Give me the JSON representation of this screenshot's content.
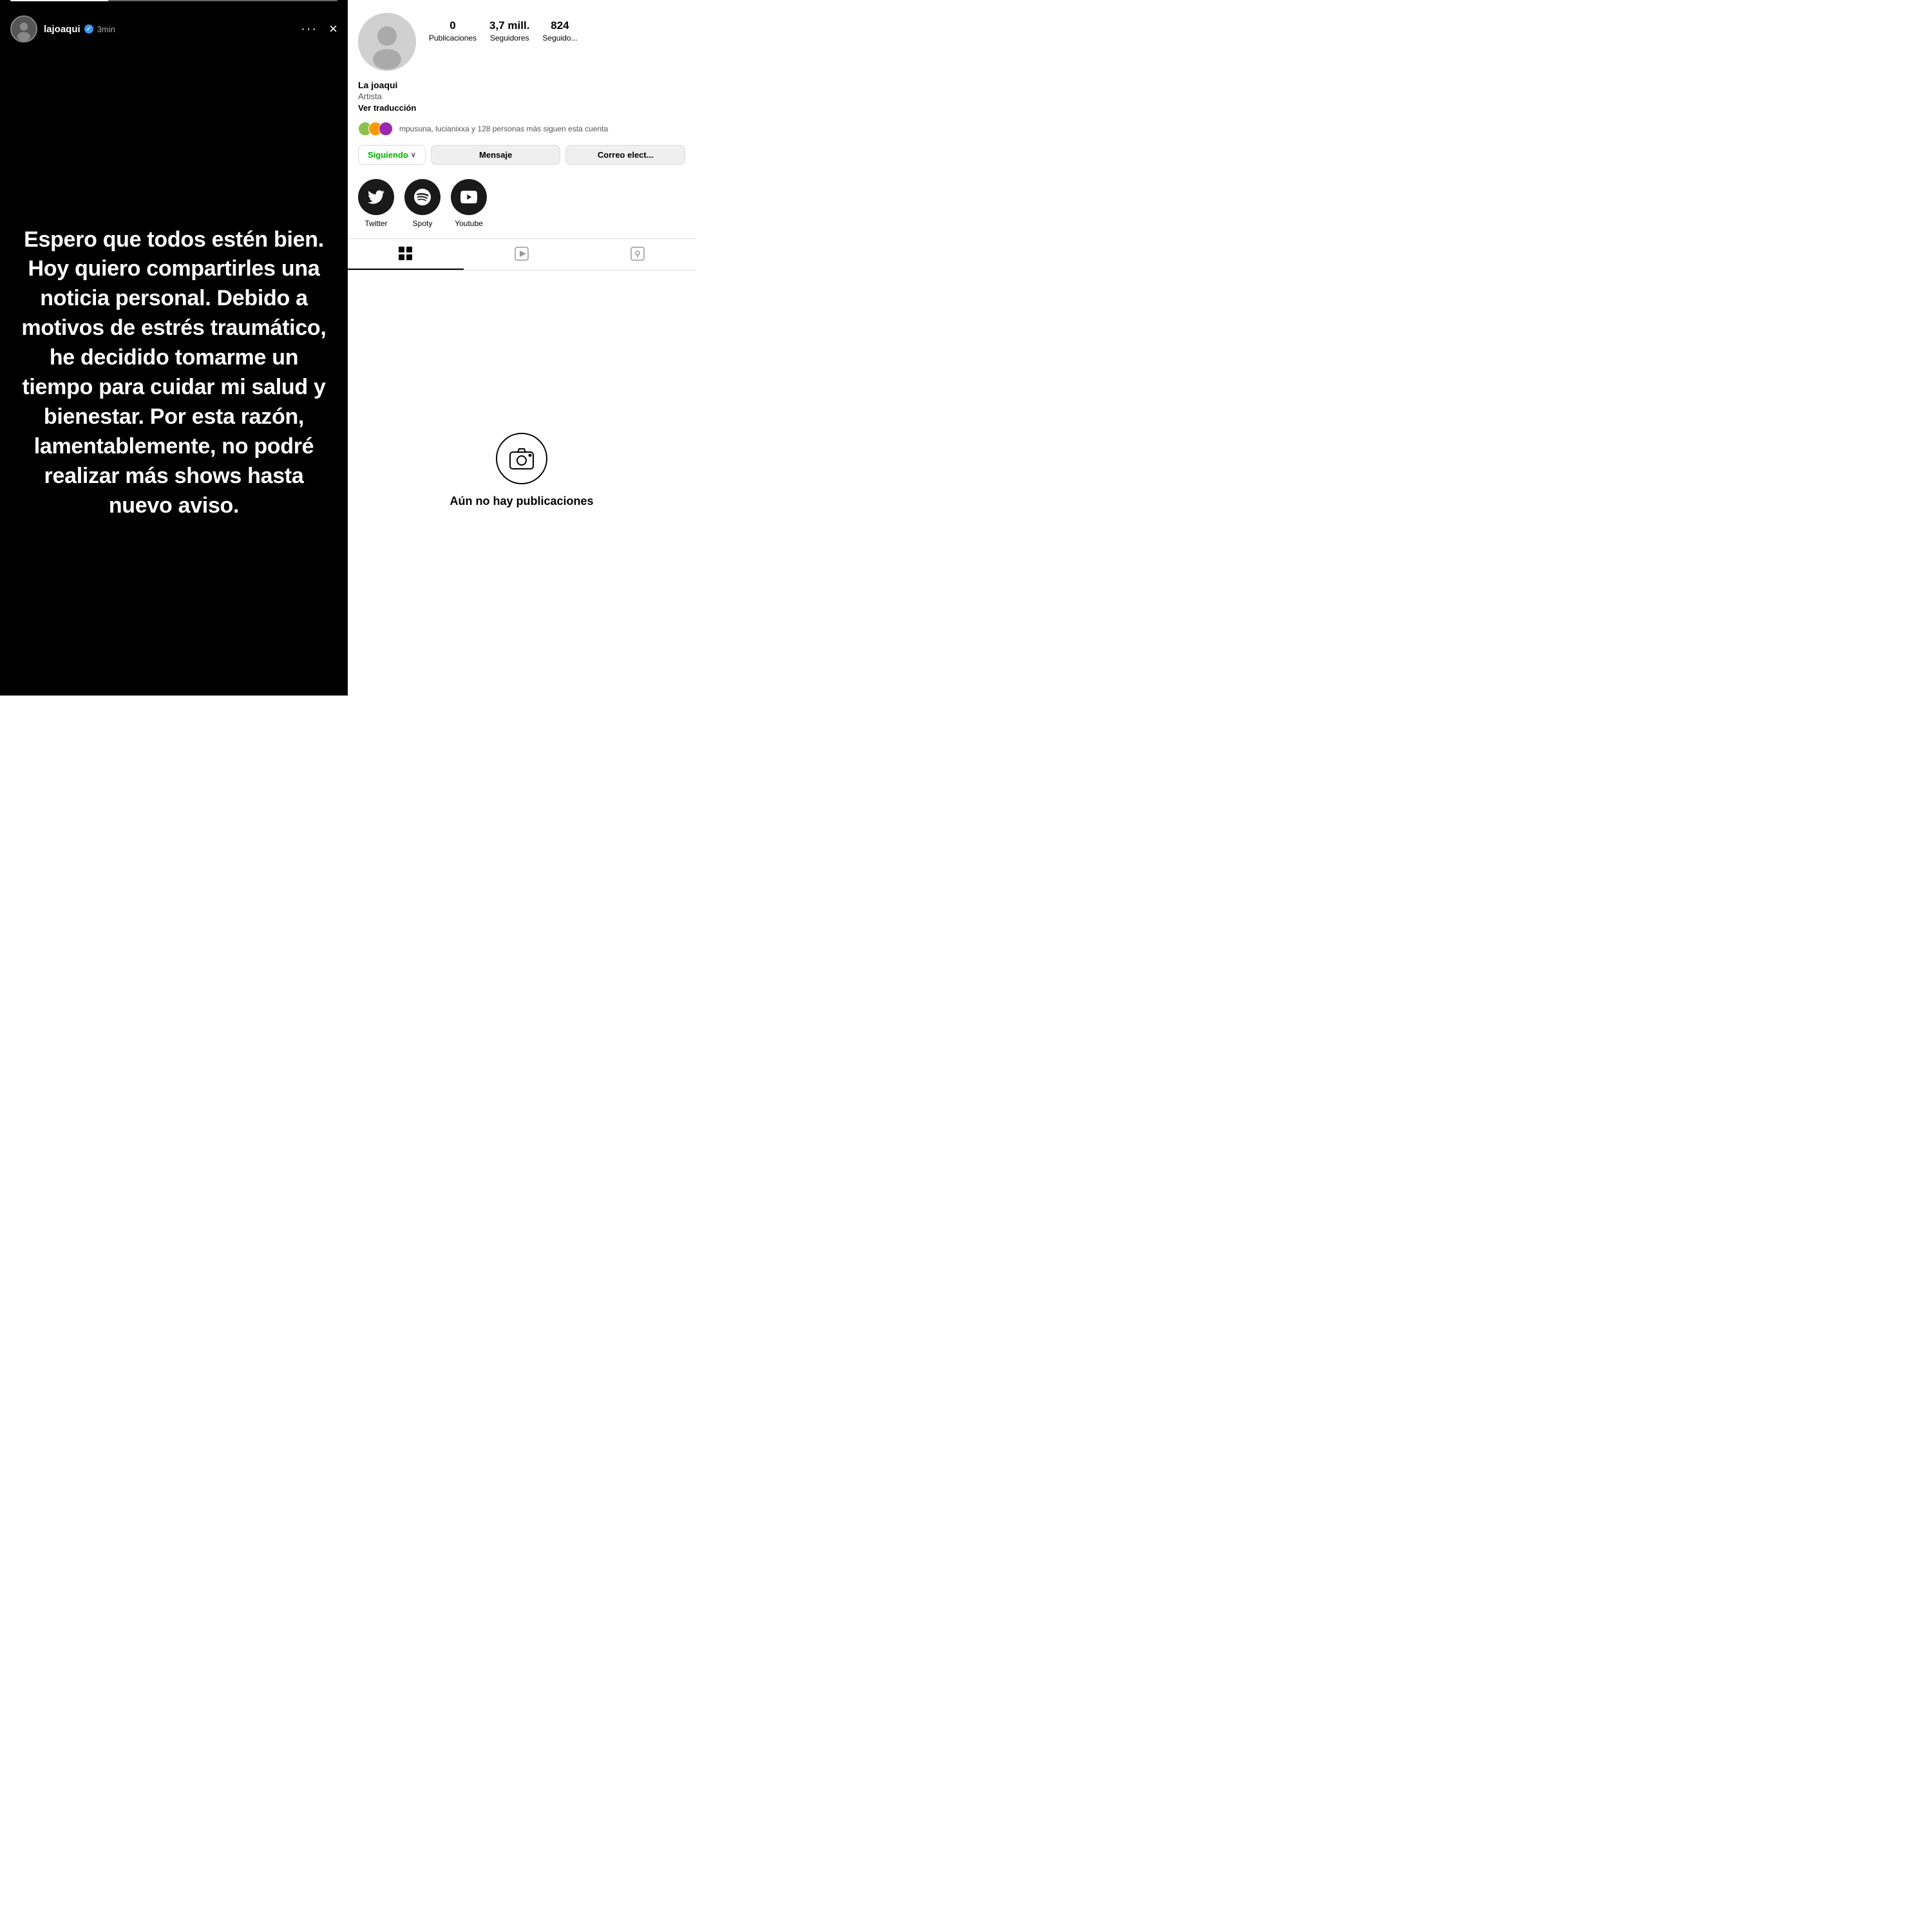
{
  "story": {
    "username": "lajoaqui",
    "verified": "✓",
    "time": "3min",
    "close_label": "×",
    "dots_label": "···",
    "text": "Espero que todos estén bien. Hoy quiero compartirles una noticia personal. Debido a motivos de estrés traumático, he decidido tomarme un tiempo para cuidar mi salud y bienestar. Por esta razón, lamentablemente, no podré realizar más shows hasta nuevo aviso."
  },
  "profile": {
    "name": "La joaqui",
    "bio": "Artista",
    "translation_label": "Ver traducción",
    "stats": {
      "publications_count": "0",
      "publications_label": "Publicaciones",
      "followers_count": "3,7 mill.",
      "followers_label": "Seguidores",
      "following_count": "824",
      "following_label": "Seguido..."
    },
    "mutual_text": "mpusuna, lucianixxa y 128 personas más siguen esta cuenta",
    "actions": {
      "following_label": "Siguiendo",
      "chevron": "∨",
      "message_label": "Mensaje",
      "email_label": "Correo elect..."
    },
    "social_links": [
      {
        "id": "twitter",
        "label": "Twitter",
        "icon": "🐦"
      },
      {
        "id": "spoty",
        "label": "Spoty",
        "icon": "♪"
      },
      {
        "id": "youtube",
        "label": "Youtube",
        "icon": "▶"
      }
    ],
    "tabs": [
      {
        "id": "grid",
        "icon": "⊞",
        "active": true
      },
      {
        "id": "reels",
        "icon": "▶",
        "active": false
      },
      {
        "id": "tagged",
        "icon": "🏷",
        "active": false
      }
    ],
    "empty_label": "Aún no hay publicaciones"
  }
}
